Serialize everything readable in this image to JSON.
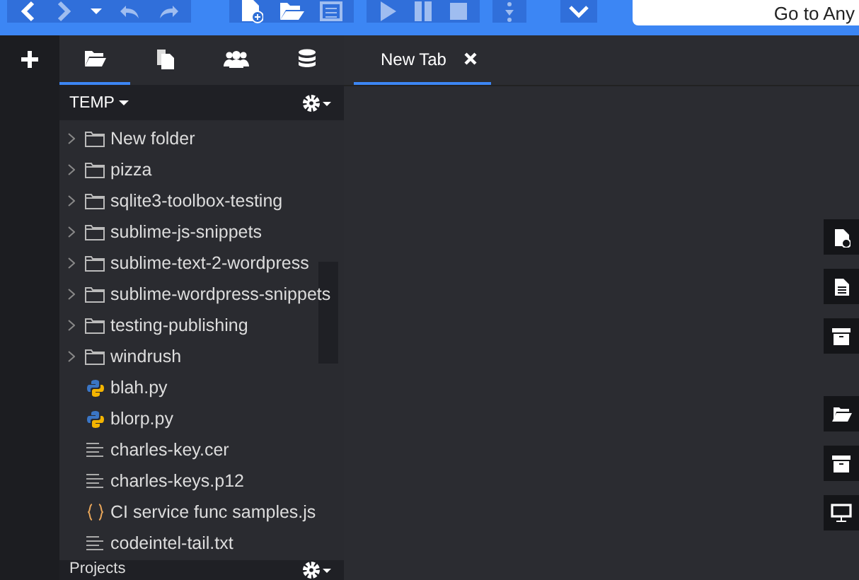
{
  "toolbar": {
    "search": {
      "placeholder": "Go to Any"
    }
  },
  "sidebar_tabs": [
    {
      "kind": "folder",
      "selected": true
    },
    {
      "kind": "files",
      "selected": false
    },
    {
      "kind": "users",
      "selected": false
    },
    {
      "kind": "database",
      "selected": false
    }
  ],
  "editor_tabs": [
    {
      "label": "New Tab",
      "selected": true
    }
  ],
  "places": {
    "title": "TEMP",
    "items": [
      {
        "name": "New folder",
        "kind": "folder"
      },
      {
        "name": "pizza",
        "kind": "folder"
      },
      {
        "name": "sqlite3-toolbox-testing",
        "kind": "folder"
      },
      {
        "name": "sublime-js-snippets",
        "kind": "folder"
      },
      {
        "name": "sublime-text-2-wordpress",
        "kind": "folder"
      },
      {
        "name": "sublime-wordpress-snippets",
        "kind": "folder"
      },
      {
        "name": "testing-publishing",
        "kind": "folder"
      },
      {
        "name": "windrush",
        "kind": "folder"
      },
      {
        "name": "blah.py",
        "kind": "python"
      },
      {
        "name": "blorp.py",
        "kind": "python"
      },
      {
        "name": "charles-key.cer",
        "kind": "text"
      },
      {
        "name": "charles-keys.p12",
        "kind": "text"
      },
      {
        "name": "CI service func samples.js",
        "kind": "script"
      },
      {
        "name": "codeintel-tail.txt",
        "kind": "text"
      }
    ]
  },
  "bottom_panel": {
    "title": "Projects"
  }
}
